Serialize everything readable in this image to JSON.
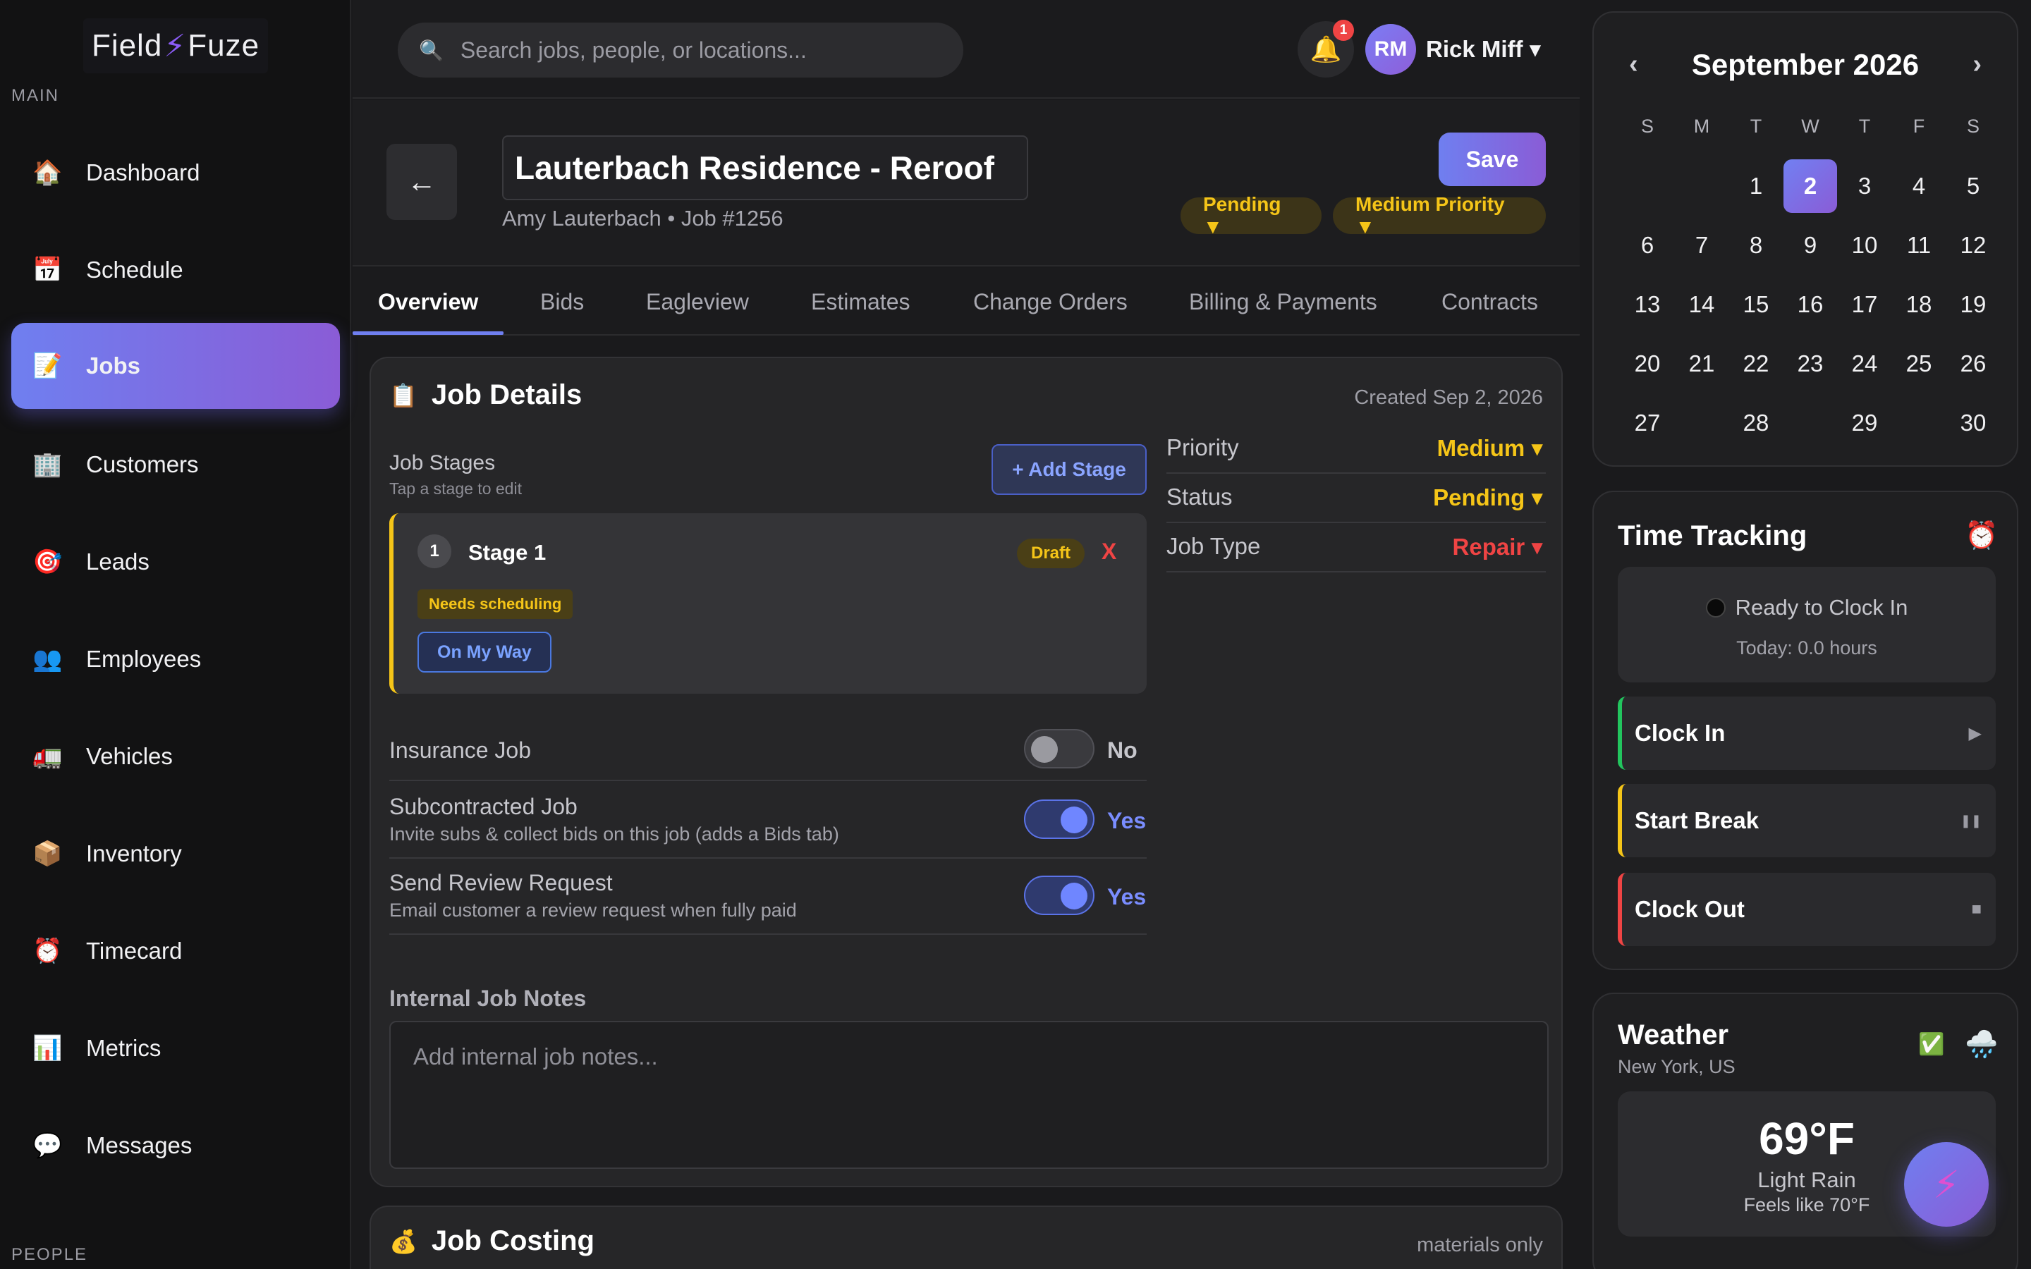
{
  "app": {
    "logo_left": "Field",
    "logo_right": "Fuze"
  },
  "sidebar": {
    "section_main": "MAIN",
    "section_people": "PEOPLE",
    "items": [
      {
        "label": "Dashboard",
        "icon": "🏠"
      },
      {
        "label": "Schedule",
        "icon": "📅"
      },
      {
        "label": "Jobs",
        "icon": "📝"
      },
      {
        "label": "Customers",
        "icon": "🏢"
      },
      {
        "label": "Leads",
        "icon": "🎯"
      },
      {
        "label": "Employees",
        "icon": "👥"
      },
      {
        "label": "Vehicles",
        "icon": "🚛"
      },
      {
        "label": "Inventory",
        "icon": "📦"
      },
      {
        "label": "Timecard",
        "icon": "⏰"
      },
      {
        "label": "Metrics",
        "icon": "📊"
      },
      {
        "label": "Messages",
        "icon": "💬"
      }
    ],
    "active": "Jobs"
  },
  "topbar": {
    "search_placeholder": "Search jobs, people, or locations...",
    "notification_count": "1",
    "user_initials": "RM",
    "user_name": "Rick Miff ▾"
  },
  "job": {
    "title": "Lauterbach Residence - Reroof",
    "subtitle": "Amy Lauterbach • Job #1256",
    "save_label": "Save",
    "status_pill": "Pending ▼",
    "priority_pill": "Medium Priority ▼"
  },
  "tabs": [
    "Overview",
    "Bids",
    "Eagleview",
    "Estimates",
    "Change Orders",
    "Billing & Payments",
    "Contracts"
  ],
  "details": {
    "title": "Job Details",
    "icon": "📋",
    "created": "Created Sep 2, 2026",
    "stages_label": "Job Stages",
    "stages_hint": "Tap a stage to edit",
    "add_stage": "+ Add Stage",
    "stage": {
      "number": "1",
      "name": "Stage 1",
      "badge": "Draft",
      "remove": "X",
      "tag": "Needs scheduling",
      "action": "On My Way"
    },
    "properties": [
      {
        "label": "Priority",
        "value": "Medium ▾",
        "color": "#f5c518"
      },
      {
        "label": "Status",
        "value": "Pending ▾",
        "color": "#f5c518"
      },
      {
        "label": "Job Type",
        "value": "Repair ▾",
        "color": "#ef4444"
      }
    ],
    "toggles": [
      {
        "label": "Insurance Job",
        "sub": "",
        "value": "No",
        "on": false
      },
      {
        "label": "Subcontracted Job",
        "sub": "Invite subs & collect bids on this job (adds a Bids tab)",
        "value": "Yes",
        "on": true
      },
      {
        "label": "Send Review Request",
        "sub": "Email customer a review request when fully paid",
        "value": "Yes",
        "on": true
      }
    ],
    "notes_label": "Internal Job Notes",
    "notes_placeholder": "Add internal job notes..."
  },
  "costing": {
    "title": "Job Costing",
    "icon": "💰",
    "note": "materials only"
  },
  "calendar": {
    "month": "September 2026",
    "prev": "‹",
    "next": "›",
    "dow": [
      "S",
      "M",
      "T",
      "W",
      "T",
      "F",
      "S"
    ],
    "weeks": [
      [
        "",
        "",
        "1",
        "2",
        "3",
        "4",
        "5"
      ],
      [
        "6",
        "7",
        "8",
        "9",
        "10",
        "11",
        "12"
      ],
      [
        "13",
        "14",
        "15",
        "16",
        "17",
        "18",
        "19"
      ],
      [
        "20",
        "21",
        "22",
        "23",
        "24",
        "25",
        "26"
      ],
      [
        "27",
        "",
        "28",
        "",
        "29",
        "",
        "30"
      ]
    ],
    "selected": "2"
  },
  "time_tracking": {
    "title": "Time Tracking",
    "alarm_icon": "⏰",
    "status": "Ready to Clock In",
    "today": "Today: 0.0 hours",
    "buttons": [
      {
        "label": "Clock In",
        "icon": "▶",
        "color": "#22c55e"
      },
      {
        "label": "Start Break",
        "icon": "❚❚",
        "color": "#f5c518"
      },
      {
        "label": "Clock Out",
        "icon": "■",
        "color": "#ef4444"
      }
    ]
  },
  "weather": {
    "title": "Weather",
    "location": "New York, US",
    "check_icon": "✅",
    "cloud_icon": "🌧️",
    "temp": "69°F",
    "condition": "Light Rain",
    "feels": "Feels like 70°F"
  },
  "fab_icon": "⚡"
}
